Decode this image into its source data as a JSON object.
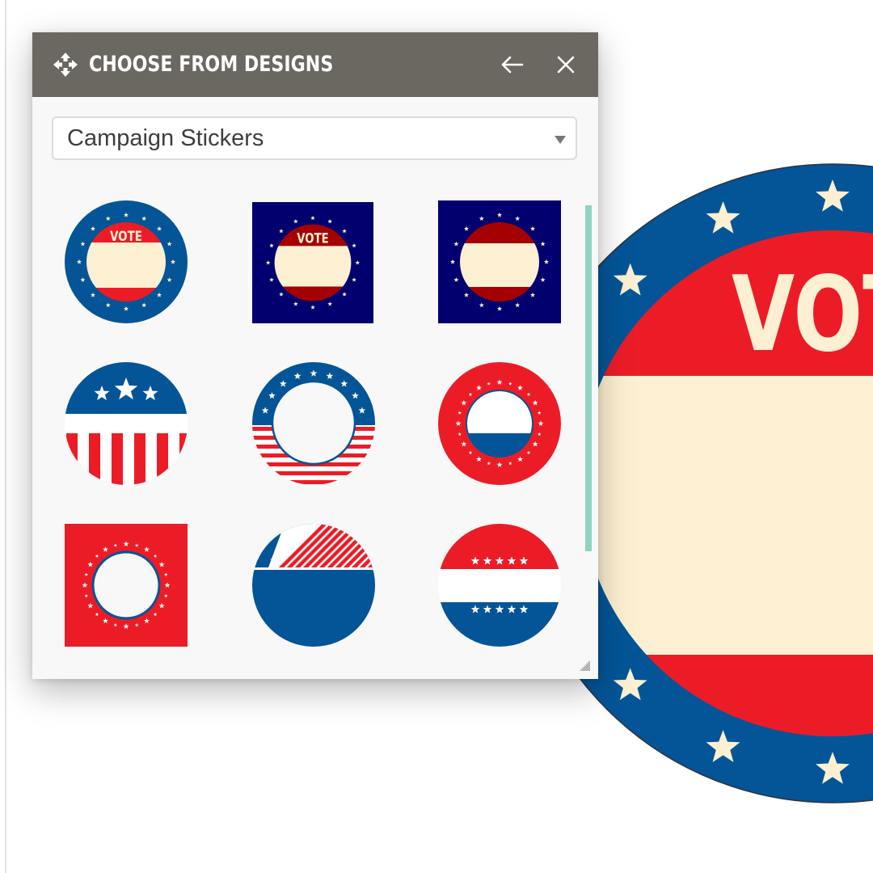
{
  "panel": {
    "title": "CHOOSE FROM DESIGNS",
    "move_icon": "move-arrows-icon",
    "back_icon": "arrow-left-icon",
    "close_icon": "close-x-icon"
  },
  "category_select": {
    "selected": "Campaign Stickers"
  },
  "designs": [
    {
      "name": "vote-badge-round-blue",
      "label": "VOTE"
    },
    {
      "name": "vote-badge-square-navy",
      "label": "VOTE"
    },
    {
      "name": "blank-badge-square-navy",
      "label": ""
    },
    {
      "name": "three-stars-vertical-stripes",
      "label": ""
    },
    {
      "name": "stars-ring-horizontal-stripes",
      "label": ""
    },
    {
      "name": "red-star-ring-blue-half",
      "label": ""
    },
    {
      "name": "red-square-star-ring",
      "label": ""
    },
    {
      "name": "diagonal-stripes-blue-circle",
      "label": ""
    },
    {
      "name": "red-white-blue-five-stars",
      "label": ""
    }
  ],
  "canvas": {
    "sticker_text": "VOTE"
  },
  "colors": {
    "header_bg": "#6b6861",
    "blue": "#035597",
    "red": "#ec1c27",
    "cream": "#fdf0d2",
    "navy": "#02006e",
    "dark_red": "#a50102",
    "scroll_thumb": "#8fd3c0"
  }
}
